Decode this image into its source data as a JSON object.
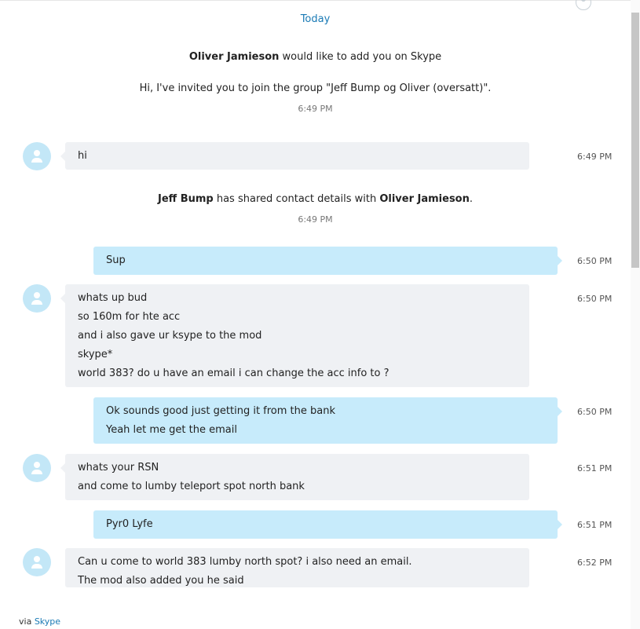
{
  "header": {
    "day_label": "Today"
  },
  "system": {
    "invite": {
      "sender": "Oliver Jamieson",
      "action": " would like to add you on Skype",
      "message": "Hi, I've invited you to join the group \"Jeff Bump og Oliver (oversatt)\".",
      "time": "6:49 PM"
    },
    "share": {
      "actor": "Jeff Bump",
      "action": " has shared contact details with ",
      "target": "Oliver Jamieson",
      "end": ".",
      "time": "6:49 PM"
    }
  },
  "messages": [
    {
      "direction": "in",
      "time": "6:49 PM",
      "lines": [
        "hi"
      ]
    },
    {
      "direction": "out",
      "time": "6:50 PM",
      "lines": [
        "Sup"
      ]
    },
    {
      "direction": "in",
      "time": "6:50 PM",
      "lines": [
        "whats up bud",
        "so 160m for hte acc",
        "and i also gave ur ksype to the mod",
        "skype*",
        "world 383? do u have an email i can change the acc info to ?"
      ]
    },
    {
      "direction": "out",
      "time": "6:50 PM",
      "lines": [
        "Ok sounds good just getting it from the bank",
        "Yeah let me get the email"
      ]
    },
    {
      "direction": "in",
      "time": "6:51 PM",
      "lines": [
        "whats your RSN",
        "and come to lumby teleport spot north bank"
      ]
    },
    {
      "direction": "out",
      "time": "6:51 PM",
      "lines": [
        "Pyr0 Lyfe"
      ]
    },
    {
      "direction": "in",
      "time": "6:52 PM",
      "lines": [
        "Can u come to world 383 lumby north spot? i also need an email.",
        "The mod also added you he said"
      ]
    }
  ],
  "footer": {
    "via": "via ",
    "link": "Skype"
  },
  "colors": {
    "accent": "#1a7ab5",
    "incoming_bubble": "#eff1f4",
    "outgoing_bubble": "#c7ebfb",
    "avatar": "#c3e7f7"
  },
  "icons": {
    "avatar": "default-user-icon",
    "profile": "user-profile-icon"
  }
}
